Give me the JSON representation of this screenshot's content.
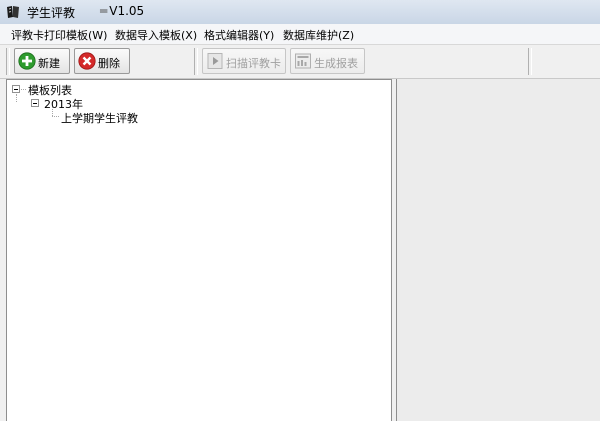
{
  "window": {
    "title": "学生评教",
    "version": "V1.05",
    "icon": "book-app-icon"
  },
  "menu": {
    "items": [
      {
        "label": "评教卡打印模板(W)"
      },
      {
        "label": "数据导入模板(X)"
      },
      {
        "label": "格式编辑器(Y)"
      },
      {
        "label": "数据库维护(Z)"
      }
    ]
  },
  "toolbar": {
    "new_label": "新建",
    "new_icon": "plus-circle-icon",
    "delete_label": "删除",
    "delete_icon": "x-circle-icon",
    "scan_label": "扫描评教卡",
    "scan_icon": "play-icon",
    "report_label": "生成报表",
    "report_icon": "report-icon"
  },
  "tree": {
    "root": "模板列表",
    "year": "2013年",
    "item": "上学期学生评教"
  },
  "colors": {
    "add_green": "#2e9b2e",
    "delete_red": "#d42a2a",
    "disabled_text": "#a0a0a0"
  }
}
